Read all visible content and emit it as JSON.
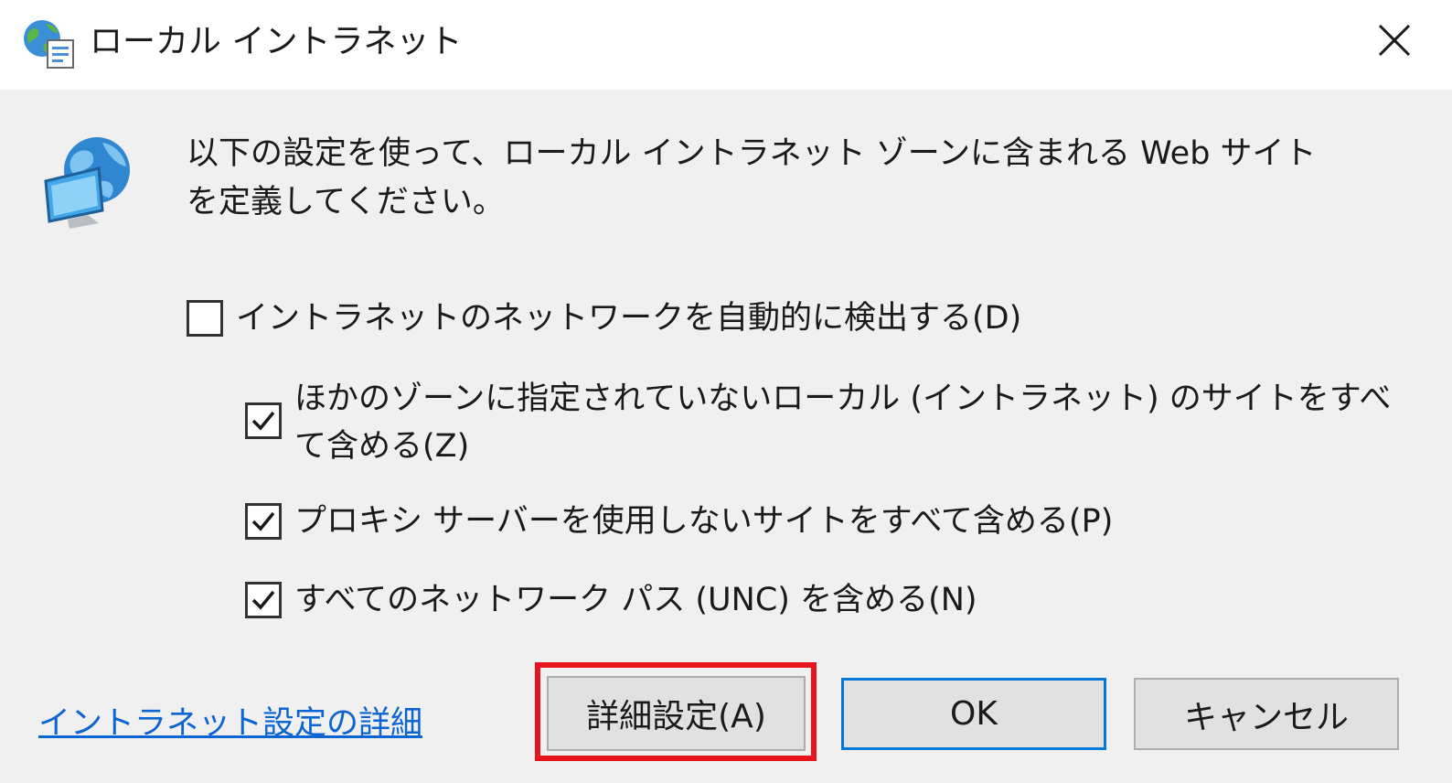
{
  "window": {
    "title": "ローカル イントラネット",
    "close_glyph": "✕"
  },
  "description": "以下の設定を使って、ローカル イントラネット ゾーンに含まれる Web サイトを定義してください。",
  "options": [
    {
      "label": "イントラネットのネットワークを自動的に検出する(D)",
      "checked": false
    },
    {
      "label": "ほかのゾーンに指定されていないローカル (イントラネット) のサイトをすべて含める(Z)",
      "checked": true
    },
    {
      "label": "プロキシ サーバーを使用しないサイトをすべて含める(P)",
      "checked": true
    },
    {
      "label": "すべてのネットワーク パス (UNC) を含める(N)",
      "checked": true
    }
  ],
  "footer": {
    "link_label": "イントラネット設定の詳細",
    "advanced_button": "詳細設定(A)",
    "ok_button": "OK",
    "cancel_button": "キャンセル"
  },
  "colors": {
    "highlight": "#e8141d",
    "link": "#0a64d2",
    "default_button_border": "#0078d7",
    "dialog_background": "#f0f0f0"
  },
  "icons": {
    "title": "globe-intranet-icon",
    "content": "globe-monitor-icon",
    "close": "close-icon",
    "check": "checkmark-icon"
  }
}
